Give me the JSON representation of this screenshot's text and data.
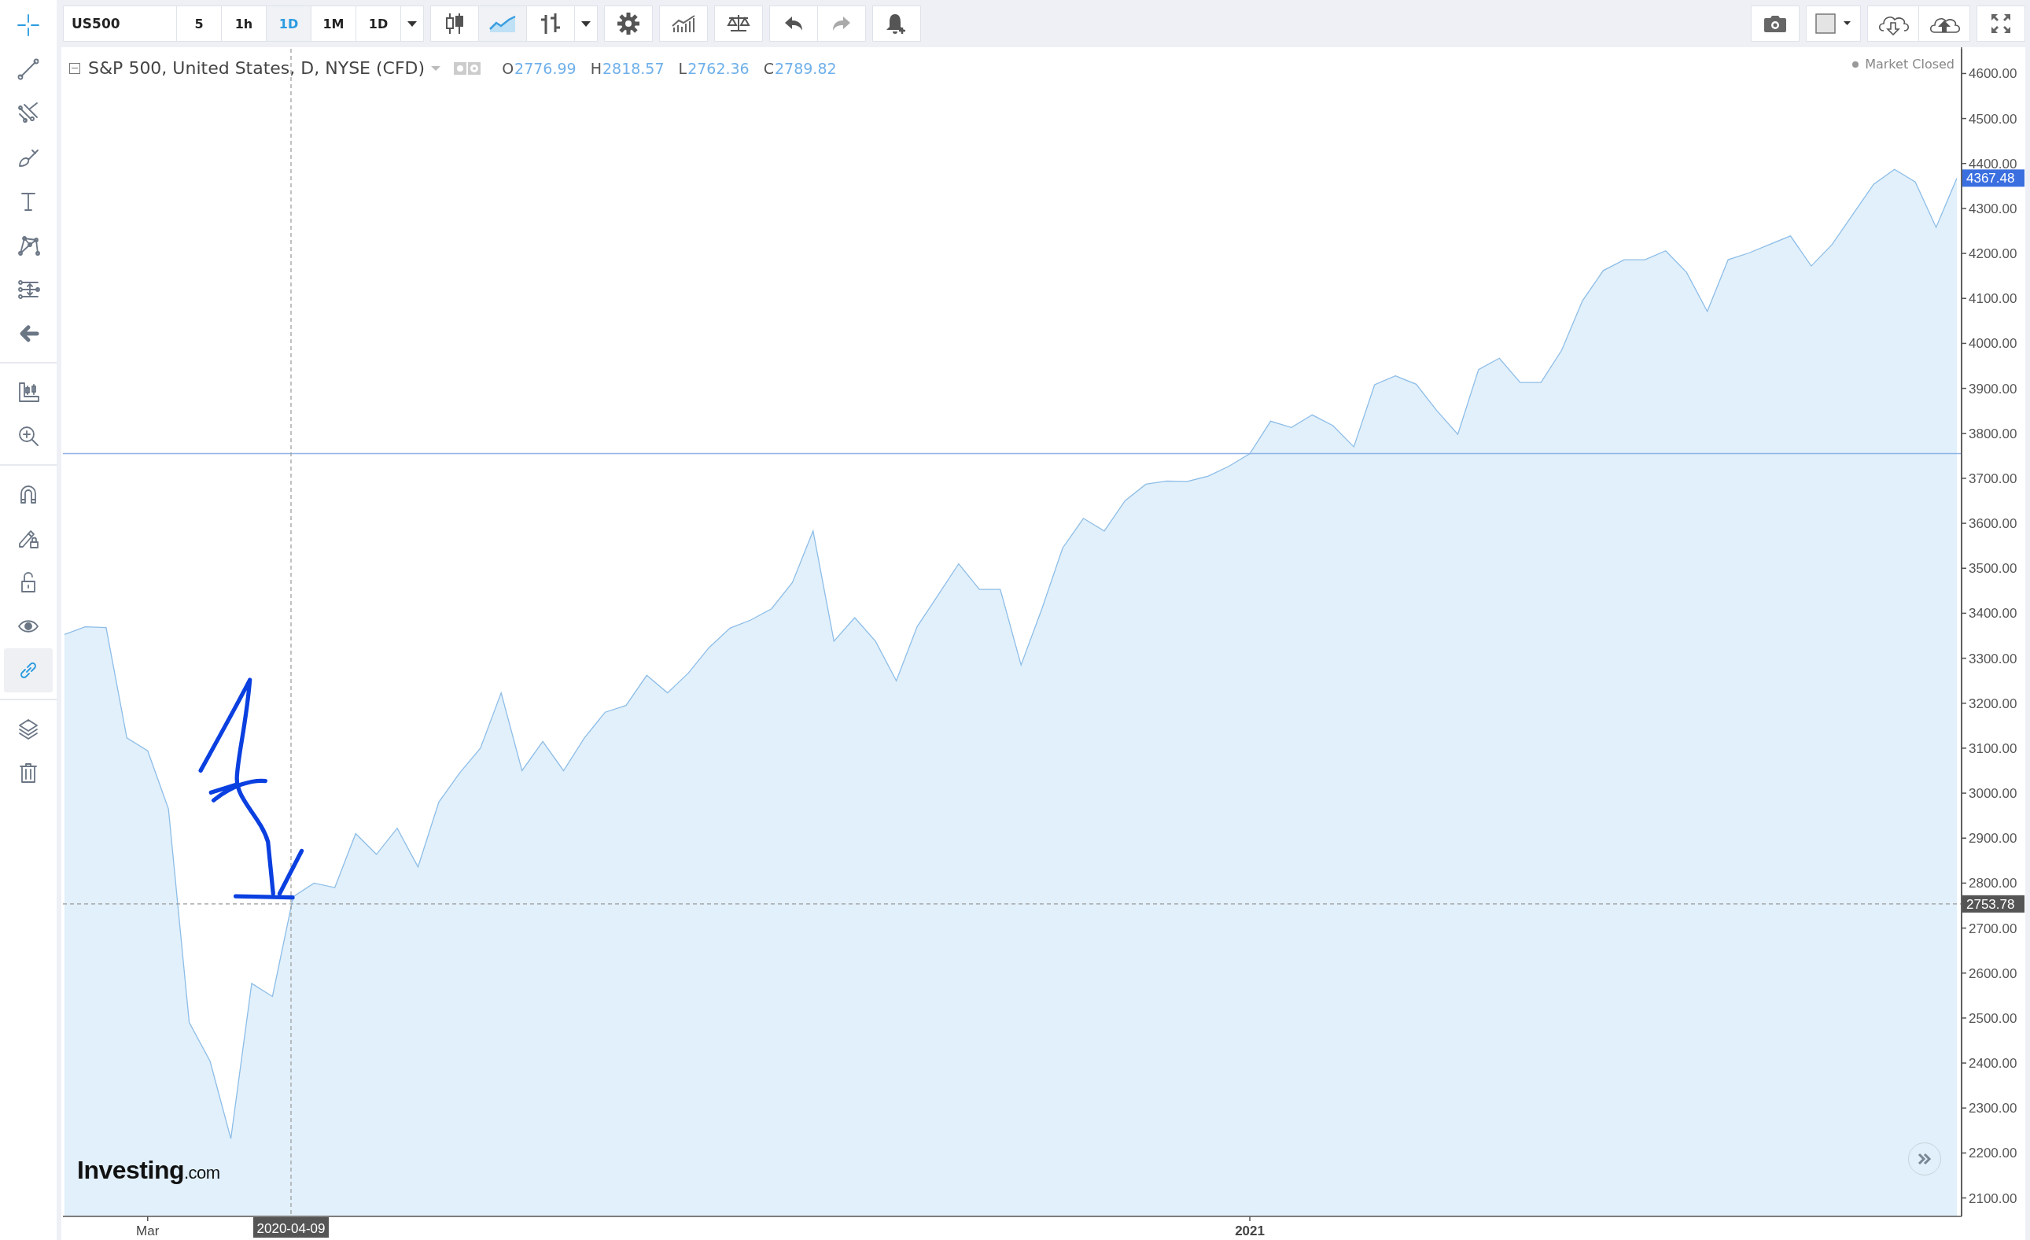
{
  "toolbar": {
    "symbol": "US500",
    "intervals": [
      {
        "label": "5",
        "selected": false
      },
      {
        "label": "1h",
        "selected": false
      },
      {
        "label": "1D",
        "selected": true
      },
      {
        "label": "1M",
        "selected": false
      },
      {
        "label": "1D",
        "selected": false
      }
    ],
    "chart_types": [
      {
        "kind": "candles",
        "selected": false
      },
      {
        "kind": "area",
        "selected": true
      },
      {
        "kind": "bars",
        "selected": false
      }
    ],
    "tools": [
      {
        "kind": "settings"
      },
      {
        "kind": "indicators"
      },
      {
        "kind": "scales"
      },
      {
        "kind": "undo"
      },
      {
        "kind": "redo"
      },
      {
        "kind": "alert"
      }
    ],
    "right_tools": [
      {
        "kind": "camera"
      },
      {
        "kind": "color"
      },
      {
        "kind": "cloud-download"
      },
      {
        "kind": "cloud-upload"
      },
      {
        "kind": "fullscreen"
      }
    ]
  },
  "sidebar": {
    "groups": [
      [
        {
          "kind": "crosshair",
          "selected": true,
          "on": false
        },
        {
          "kind": "trend-line",
          "selected": false,
          "on": false
        },
        {
          "kind": "fork",
          "selected": false,
          "on": false
        },
        {
          "kind": "brush",
          "selected": false,
          "on": false
        },
        {
          "kind": "text",
          "selected": false,
          "on": false
        },
        {
          "kind": "pattern",
          "selected": false,
          "on": false
        },
        {
          "kind": "measure",
          "selected": false,
          "on": false
        },
        {
          "kind": "back",
          "selected": false,
          "on": false
        }
      ],
      [
        {
          "kind": "ruler",
          "selected": false,
          "on": false
        },
        {
          "kind": "zoom",
          "selected": false,
          "on": false
        }
      ],
      [
        {
          "kind": "magnet",
          "selected": false,
          "on": false
        },
        {
          "kind": "pencil-lock",
          "selected": false,
          "on": false
        },
        {
          "kind": "lock",
          "selected": false,
          "on": false
        },
        {
          "kind": "eye",
          "selected": false,
          "on": false
        },
        {
          "kind": "link",
          "selected": true,
          "on": true
        }
      ],
      [
        {
          "kind": "layers",
          "selected": false,
          "on": false
        },
        {
          "kind": "trash",
          "selected": false,
          "on": false
        }
      ]
    ]
  },
  "legend": {
    "title": "S&P 500, United States, D, NYSE (CFD)",
    "ohlc": [
      {
        "label": "O",
        "value": "2776.99"
      },
      {
        "label": "H",
        "value": "2818.57"
      },
      {
        "label": "L",
        "value": "2762.36"
      },
      {
        "label": "C",
        "value": "2789.82"
      }
    ]
  },
  "market_status": "Market Closed",
  "logo": "**Investing**.com",
  "last_price": "4367.48",
  "crosshair": {
    "price": "2753.78",
    "date": "2020-04-09"
  },
  "chart_data": {
    "type": "area",
    "ylim": [
      2059,
      4655
    ],
    "categories": [
      null,
      null,
      null,
      null,
      "Mar",
      null,
      null,
      null,
      null,
      null,
      null,
      null,
      null,
      null,
      null,
      null,
      null,
      null,
      null,
      null,
      null,
      null,
      null,
      null,
      null,
      null,
      null,
      null,
      null,
      null,
      null,
      null,
      null,
      null,
      null,
      null,
      null,
      null,
      null,
      null,
      null,
      null,
      null,
      null,
      null,
      null,
      null,
      null,
      null,
      null,
      null,
      null,
      null,
      null,
      null,
      null,
      null,
      "2021",
      null,
      null,
      null,
      null,
      null,
      null,
      null,
      null,
      null,
      null,
      null,
      null,
      null,
      null,
      null,
      null,
      null,
      null,
      null,
      null,
      null,
      null,
      null,
      null,
      null,
      null,
      null,
      null,
      null,
      null,
      null,
      null,
      null,
      null
    ],
    "yticks": [
      {
        "value": 2100,
        "label": "2100.00"
      },
      {
        "value": 2200,
        "label": "2200.00"
      },
      {
        "value": 2300,
        "label": "2300.00"
      },
      {
        "value": 2400,
        "label": "2400.00"
      },
      {
        "value": 2500,
        "label": "2500.00"
      },
      {
        "value": 2600,
        "label": "2600.00"
      },
      {
        "value": 2700,
        "label": "2700.00"
      },
      {
        "value": 2800,
        "label": "2800.00"
      },
      {
        "value": 2900,
        "label": "2900.00"
      },
      {
        "value": 3000,
        "label": "3000.00"
      },
      {
        "value": 3100,
        "label": "3100.00"
      },
      {
        "value": 3200,
        "label": "3200.00"
      },
      {
        "value": 3300,
        "label": "3300.00"
      },
      {
        "value": 3400,
        "label": "3400.00"
      },
      {
        "value": 3500,
        "label": "3500.00"
      },
      {
        "value": 3600,
        "label": "3600.00"
      },
      {
        "value": 3700,
        "label": "3700.00"
      },
      {
        "value": 3800,
        "label": "3800.00"
      },
      {
        "value": 3900,
        "label": "3900.00"
      },
      {
        "value": 4000,
        "label": "4000.00"
      },
      {
        "value": 4100,
        "label": "4100.00"
      },
      {
        "value": 4200,
        "label": "4200.00"
      },
      {
        "value": 4300,
        "label": "4300.00"
      },
      {
        "value": 4400,
        "label": "4400.00"
      },
      {
        "value": 4500,
        "label": "4500.00"
      },
      {
        "value": 4600,
        "label": "4600.00"
      }
    ],
    "series": [
      {
        "color": "#8dbde8",
        "values": [
          3353,
          3370,
          3368,
          3123,
          3094,
          2965,
          2490,
          2404,
          2232,
          2577,
          2548,
          2770,
          2800,
          2790,
          2910,
          2864,
          2922,
          2836,
          2980,
          3045,
          3100,
          3223,
          3050,
          3115,
          3050,
          3123,
          3180,
          3195,
          3262,
          3223,
          3267,
          3324,
          3367,
          3385,
          3410,
          3468,
          3583,
          3338,
          3390,
          3338,
          3250,
          3370,
          3440,
          3510,
          3453,
          3453,
          3285,
          3410,
          3545,
          3611,
          3583,
          3650,
          3687,
          3694,
          3693,
          3705,
          3727,
          3755,
          3827,
          3813,
          3841,
          3817,
          3770,
          3908,
          3928,
          3909,
          3850,
          3798,
          3942,
          3967,
          3913,
          3913,
          3985,
          4095,
          4162,
          4186,
          4186,
          4206,
          4158,
          4071,
          4186,
          4201,
          4220,
          4239,
          4172,
          4220,
          4287,
          4354,
          4387,
          4359,
          4258,
          4367
        ]
      }
    ],
    "ref_lines": [
      {
        "axis": "y",
        "value": 3755
      }
    ]
  }
}
